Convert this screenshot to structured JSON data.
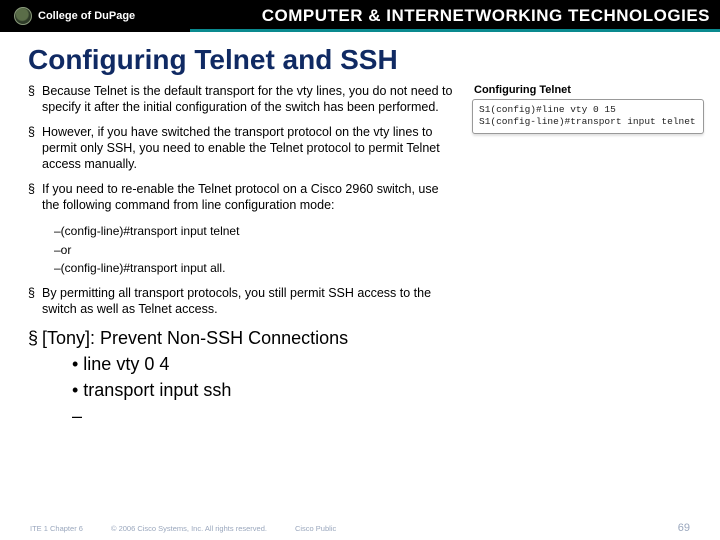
{
  "header": {
    "brand": "College of DuPage",
    "title": "COMPUTER & INTERNETWORKING TECHNOLOGIES"
  },
  "slide": {
    "title": "Configuring Telnet and SSH",
    "bullets": [
      "Because Telnet is the default transport for the vty lines, you do not need to specify it after the initial configuration of the switch has been performed.",
      "However, if you have switched the transport protocol on the vty lines to permit only SSH, you need to enable the Telnet protocol to permit Telnet access manually.",
      "If you need to re-enable the Telnet protocol on a Cisco 2960 switch, use the following command from line configuration mode:"
    ],
    "sublist": [
      "–(config-line)#transport input telnet",
      "–or",
      "–(config-line)#transport input all."
    ],
    "bullet4": "By permitting all transport protocols, you still permit SSH access to the switch as well as Telnet access.",
    "tony": {
      "head": "[Tony]: Prevent Non-SSH Connections",
      "lines": [
        "• line vty 0 4",
        "• transport input ssh"
      ],
      "dash": "–"
    },
    "sidebox": {
      "title": "Configuring Telnet",
      "code": "S1(config)#line vty 0 15\nS1(config-line)#transport input telnet"
    }
  },
  "footer": {
    "left": "ITE 1 Chapter 6",
    "center": "© 2006 Cisco Systems, Inc. All rights reserved.",
    "right": "Cisco Public",
    "page": "69"
  }
}
